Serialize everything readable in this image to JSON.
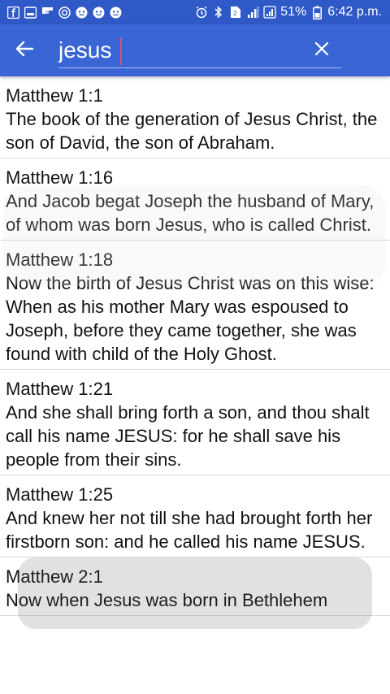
{
  "status_bar": {
    "battery": "51%",
    "time": "6:42 p.m."
  },
  "search": {
    "value": "jesus"
  },
  "results": [
    {
      "ref": "Matthew 1:1",
      "text": "The book of the generation of Jesus Christ, the son of David, the son of Abraham."
    },
    {
      "ref": "Matthew 1:16",
      "text": "And Jacob begat Joseph the husband of Mary, of whom was born Jesus, who is called Christ."
    },
    {
      "ref": "Matthew 1:18",
      "text": "Now the birth of Jesus Christ was on this wise: When as his mother Mary was espoused to Joseph, before they came together, she was found with child of the Holy Ghost."
    },
    {
      "ref": "Matthew 1:21",
      "text": "And she shall bring forth a son, and thou shalt call his name JESUS: for he shall save his people from their sins."
    },
    {
      "ref": "Matthew 1:25",
      "text": "And knew her not till she had brought forth her firstborn son: and he called his name JESUS."
    },
    {
      "ref": "Matthew 2:1",
      "text": "Now when Jesus was born in Bethlehem"
    }
  ],
  "colors": {
    "status_bar": "#2f59c7",
    "app_bar": "#3a66d5",
    "caret": "#e8477a"
  },
  "icons": {
    "back": "arrow-left-icon",
    "clear": "close-icon"
  }
}
